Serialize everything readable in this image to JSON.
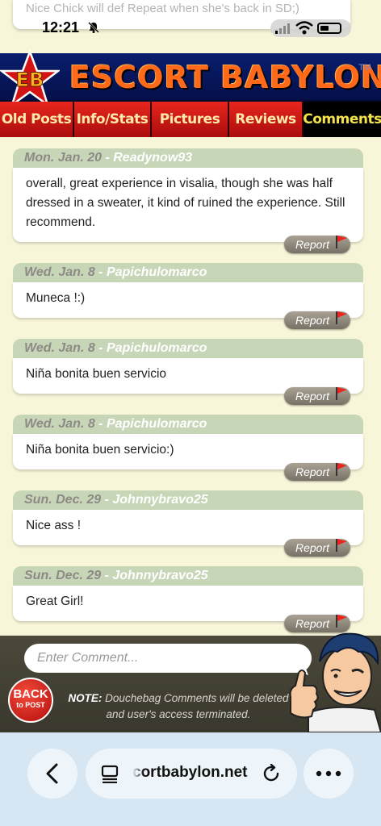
{
  "status": {
    "time": "12:21"
  },
  "previous_comment": {
    "text": "Nice Chick will def Repeat when she's back in SD;)"
  },
  "site": {
    "logo_badge": "EB",
    "logo_text": "ESCORT  BABYLON",
    "trademark": "TM"
  },
  "nav": {
    "tabs": [
      {
        "label": "Old Posts",
        "active": false
      },
      {
        "label": "Info/Stats",
        "active": false
      },
      {
        "label": "Pictures",
        "active": false
      },
      {
        "label": "Reviews",
        "active": false
      },
      {
        "label": "Comments",
        "active": true
      }
    ]
  },
  "comments": [
    {
      "date": "Mon. Jan. 20",
      "user": "Readynow93",
      "text": "overall, great experience in visalia, though she was half dressed in a sweater, it kind of ruined the experience. Still recommend.",
      "report": "Report"
    },
    {
      "date": "Wed. Jan. 8",
      "user": "Papichulomarco",
      "text": "Muneca !:)",
      "report": "Report"
    },
    {
      "date": "Wed. Jan. 8",
      "user": "Papichulomarco",
      "text": "Niña bonita buen servicio",
      "report": "Report"
    },
    {
      "date": "Wed. Jan. 8",
      "user": "Papichulomarco",
      "text": "Niña bonita buen servicio:)",
      "report": "Report"
    },
    {
      "date": "Sun. Dec. 29",
      "user": "Johnnybravo25",
      "text": "Nice ass !",
      "report": "Report"
    },
    {
      "date": "Sun. Dec. 29",
      "user": "Johnnybravo25",
      "text": "Great Girl!",
      "report": "Report"
    }
  ],
  "comment_entry": {
    "placeholder": "Enter Comment...",
    "back_label": "BACK",
    "back_sub": "to POST",
    "note_prefix": "NOTE:",
    "note_text": " Douchebag Comments will be deleted and user's access terminated."
  },
  "browser": {
    "url": "cortbabylon.net"
  },
  "colors": {
    "nav_red": "#e8261e",
    "active_tab_text": "#f3e24a",
    "comment_header": "#c8d6b8",
    "page_bg": "#f8f6d9"
  }
}
